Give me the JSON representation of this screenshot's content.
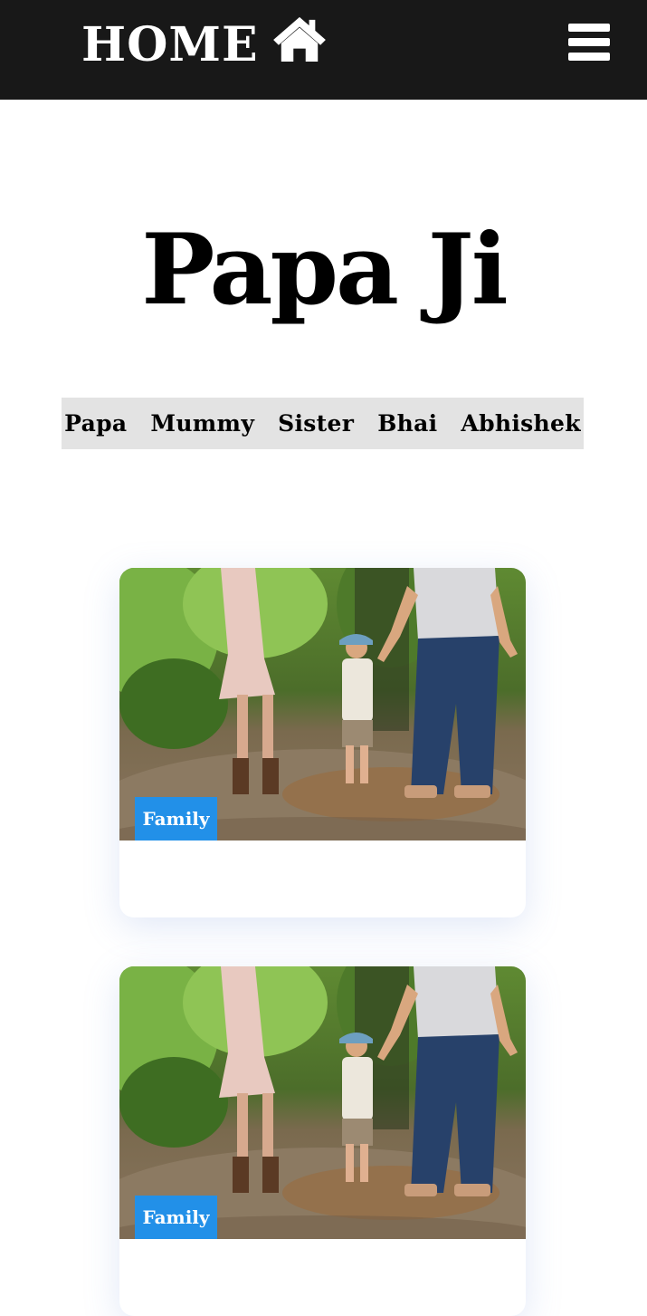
{
  "header": {
    "home_label": "HOME",
    "home_icon": "home-icon",
    "menu_icon": "hamburger-menu-icon",
    "background": "#181818"
  },
  "site": {
    "title": "Papa Ji"
  },
  "nav": {
    "items": [
      {
        "label": "Papa"
      },
      {
        "label": "Mummy"
      },
      {
        "label": "Sister"
      },
      {
        "label": "Bhai"
      },
      {
        "label": "Abhishek"
      }
    ],
    "background": "#e3e3e3"
  },
  "posts": [
    {
      "category": "Family",
      "image": "family-walking-photo"
    },
    {
      "category": "Family",
      "image": "family-walking-photo"
    }
  ],
  "colors": {
    "tag": "#2290e8",
    "title": "#000000"
  }
}
